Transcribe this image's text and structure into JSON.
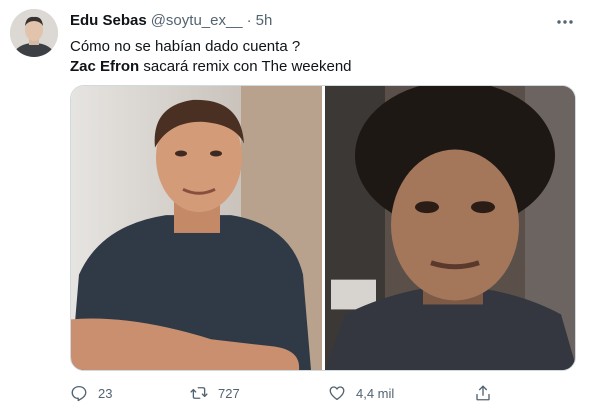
{
  "tweet": {
    "display_name": "Edu Sebas",
    "handle": "@soytu_ex__",
    "separator": "·",
    "time": "5h",
    "line1": "Cómo no se habían dado cuenta ?",
    "line2_bold": "Zac Efron",
    "line2_rest": " sacará remix con The weekend"
  },
  "actions": {
    "reply_count": "23",
    "retweet_count": "727",
    "like_count": "4,4 mil"
  },
  "icons": {
    "more": "more-horizontal-icon",
    "reply": "reply-icon",
    "retweet": "retweet-icon",
    "like": "heart-icon",
    "share": "share-icon"
  },
  "colors": {
    "text": "#0f1419",
    "secondary": "#536471",
    "border": "#cfd9de"
  }
}
